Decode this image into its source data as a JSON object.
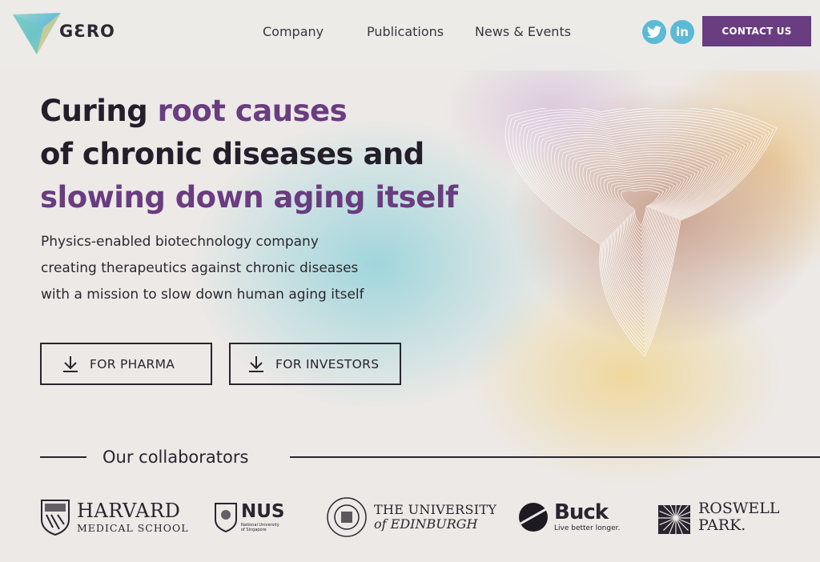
{
  "brand": {
    "logo_text": "GƐRO",
    "accent": "#6a3c80",
    "social_color": "#5bbad5"
  },
  "nav": {
    "items": [
      {
        "label": "Company"
      },
      {
        "label": "Publications"
      },
      {
        "label": "News & Events"
      }
    ],
    "social": [
      {
        "icon": "twitter-icon",
        "glyph": "🐦"
      },
      {
        "icon": "linkedin-icon",
        "glyph": "in"
      }
    ],
    "contact_label": "CONTACT US"
  },
  "hero": {
    "title_line1_a": "Curing ",
    "title_line1_b": "root causes",
    "title_line2": "of chronic diseases and",
    "title_line3": "slowing down aging itself",
    "subtitle_lines": [
      "Physics-enabled biotechnology company",
      "creating therapeutics against chronic diseases",
      "with a mission to slow down human aging itself"
    ],
    "buttons": [
      {
        "label": "FOR PHARMA",
        "icon": "download-icon"
      },
      {
        "label": "FOR INVESTORS",
        "icon": "download-icon"
      }
    ]
  },
  "collaborators": {
    "title": "Our collaborators",
    "partners": [
      {
        "name_line1": "HARVARD",
        "name_line2": "MEDICAL SCHOOL"
      },
      {
        "name_line1": "NUS",
        "name_line2": "National University of Singapore"
      },
      {
        "name_line1": "THE UNIVERSITY",
        "name_line2": "of EDINBURGH"
      },
      {
        "name_line1": "Buck",
        "name_line2": "Live better longer."
      },
      {
        "name_line1": "ROSWELL",
        "name_line2": "PARK."
      }
    ]
  }
}
